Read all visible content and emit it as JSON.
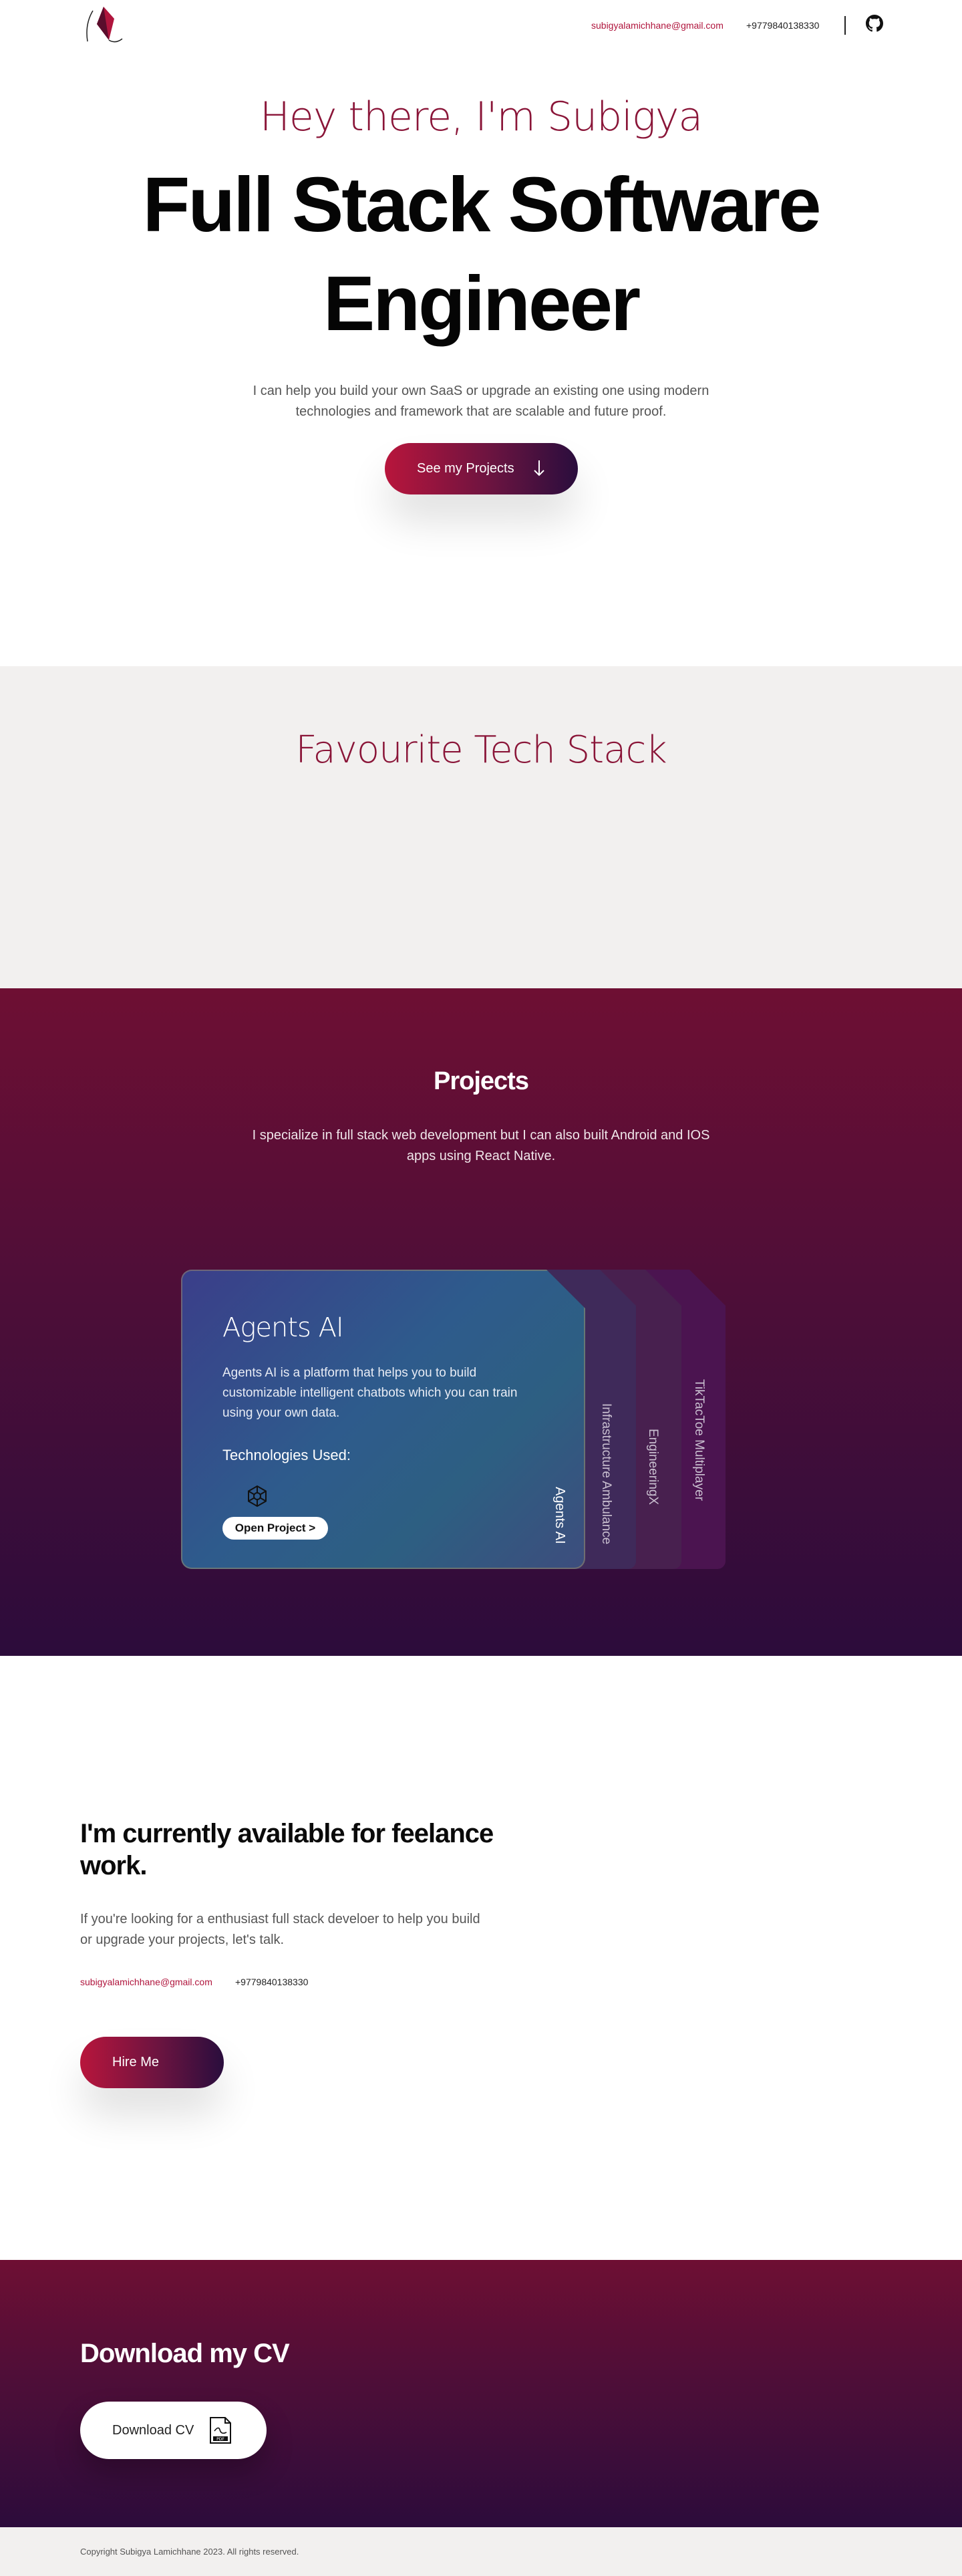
{
  "nav": {
    "logo": "kite-logo",
    "email": "subigyalamichhane@gmail.com",
    "phone": "+9779840138330",
    "github_icon": "github-icon"
  },
  "hero": {
    "greeting": "Hey there, I'm Subigya",
    "title": "Full Stack Software Engineer",
    "subtitle": "I can help you build your own SaaS or upgrade an existing one using modern technologies and framework that are scalable and future proof.",
    "cta_label": "See my Projects",
    "cta_icon": "arrow-down-icon"
  },
  "tech_stack": {
    "title": "Favourite Tech Stack"
  },
  "projects": {
    "title": "Projects",
    "subtitle": "I specialize in full stack web development but I can also built Android and IOS apps using React Native.",
    "active": {
      "name": "Agents AI",
      "description": "Agents AI is a platform that helps you to build customizable intelligent chatbots which you can train using your own data.",
      "technologies_label": "Technologies Used:",
      "open_label": "Open Project >"
    },
    "tabs": [
      "Agents AI",
      "Infrastructure Ambulance",
      "EngineeringX",
      "TikTacToe Multiplayer"
    ]
  },
  "freelance": {
    "title": "I'm currently available for feelance work.",
    "subtitle": "If you're looking for a enthusiast full stack develoer to help you build or upgrade your projects, let's talk.",
    "email": "subigyalamichhane@gmail.com",
    "phone": "+9779840138330",
    "cta_label": "Hire Me"
  },
  "cv": {
    "title": "Download my CV",
    "button_label": "Download CV",
    "icon": "pdf-file-icon"
  },
  "footer": {
    "copyright": "Copyright Subigya Lamichhane 2023. All rights reserved."
  },
  "colors": {
    "accent": "#b0153d",
    "gradient_start": "#b8153c",
    "gradient_end": "#2a0d3d",
    "section_bg": "#f2f0ef"
  }
}
